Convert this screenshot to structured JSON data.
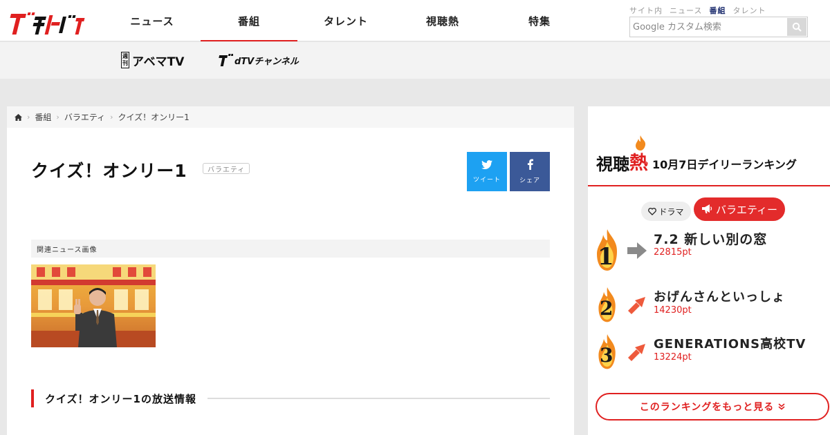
{
  "header": {
    "logo_text": "ザテレビジョン",
    "nav": [
      {
        "label": "ニュース",
        "active": false
      },
      {
        "label": "番組",
        "active": true
      },
      {
        "label": "タレント",
        "active": false
      },
      {
        "label": "視聴熱",
        "active": false
      },
      {
        "label": "特集",
        "active": false
      }
    ],
    "search_scopes": [
      {
        "label": "サイト内",
        "active": false
      },
      {
        "label": "ニュース",
        "active": false
      },
      {
        "label": "番組",
        "active": true
      },
      {
        "label": "タレント",
        "active": false
      }
    ],
    "search_placeholder": "Google カスタム検索"
  },
  "subbar": {
    "abema_tag_top": "週",
    "abema_tag_bottom": "刊",
    "abema_label": "アベマTV",
    "dtv_label": "dTVチャンネル"
  },
  "breadcrumb": [
    "番組",
    "バラエティ",
    "クイズ！オンリー1"
  ],
  "main": {
    "title": "クイズ！オンリー1",
    "genre": "バラエティ",
    "share": {
      "tweet": "ツイート",
      "facebook": "シェア"
    },
    "related_heading": "関連ニュース画像",
    "broadcast_heading": "クイズ！オンリー1の放送情報"
  },
  "ranking": {
    "heading_a": "視聴",
    "heading_b": "熱",
    "heading_date": "10月7日デイリーランキング",
    "tabs": [
      {
        "label": "ドラマ",
        "active": false
      },
      {
        "label": "バラエティー",
        "active": true
      }
    ],
    "items": [
      {
        "rank": "1",
        "title": "7.2 新しい別の窓",
        "points": "22815pt",
        "trend": "same"
      },
      {
        "rank": "2",
        "title": "おげんさんといっしょ",
        "points": "14230pt",
        "trend": "up"
      },
      {
        "rank": "3",
        "title": "GENERATIONS高校TV",
        "points": "13224pt",
        "trend": "up"
      }
    ],
    "more_label": "このランキングをもっと見る",
    "colors": {
      "accent": "#e02020",
      "flame": "#f28a1e",
      "arrow_up": "#ee5a3c",
      "arrow_same": "#8a8a8a"
    }
  }
}
